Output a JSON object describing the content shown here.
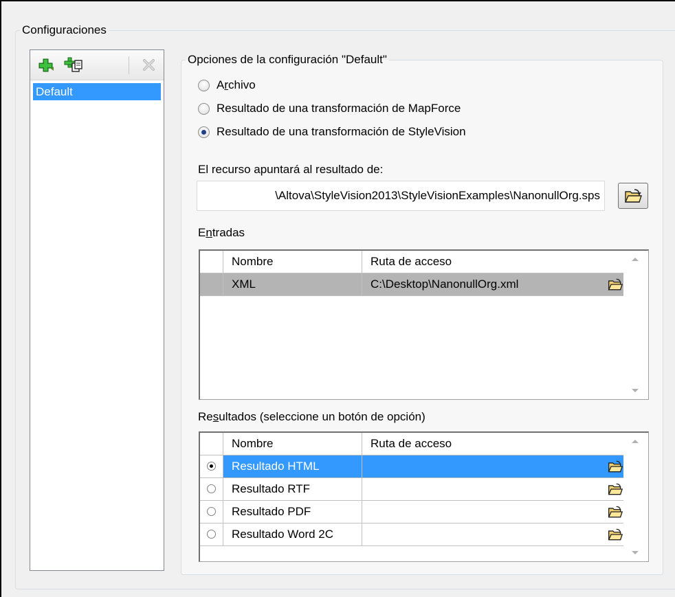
{
  "config_group": {
    "title": "Configuraciones",
    "items": [
      {
        "label": "Default",
        "selected": true
      }
    ],
    "toolbar": [
      {
        "name": "add-config",
        "icon": "green-plus-icon",
        "enabled": true
      },
      {
        "name": "copy-config",
        "icon": "green-plus-copy-icon",
        "enabled": true
      },
      {
        "name": "delete-config",
        "icon": "delete-x-icon",
        "enabled": false
      }
    ]
  },
  "options_group": {
    "title": "Opciones de la configuración \"Default\"",
    "radios": [
      {
        "label": "Archivo",
        "checked": false
      },
      {
        "label": "Resultado de una transformación de MapForce",
        "checked": false
      },
      {
        "label": "Resultado de una transformación de StyleVision",
        "checked": true
      }
    ],
    "target_label": "El recurso apuntará al resultado de:",
    "target_path": "\\Altova\\StyleVision2013\\StyleVisionExamples\\NanonullOrg.sps"
  },
  "inputs": {
    "label": "Entradas",
    "columns": [
      "Nombre",
      "Ruta de acceso"
    ],
    "rows": [
      {
        "name": "XML",
        "path": "C:\\Desktop\\NanonullOrg.xml"
      }
    ]
  },
  "outputs": {
    "label": "Resultados (seleccione un botón de opción)",
    "columns": [
      "Nombre",
      "Ruta de acceso"
    ],
    "rows": [
      {
        "name": "Resultado HTML",
        "path": "",
        "checked": true
      },
      {
        "name": "Resultado RTF",
        "path": "",
        "checked": false
      },
      {
        "name": "Resultado PDF",
        "path": "",
        "checked": false
      },
      {
        "name": "Resultado Word 2C",
        "path": "",
        "checked": false
      }
    ]
  },
  "colors": {
    "selection": "#3399ff",
    "group_border": "#d5dfe5",
    "dialog_bg": "#f0f0f0"
  }
}
